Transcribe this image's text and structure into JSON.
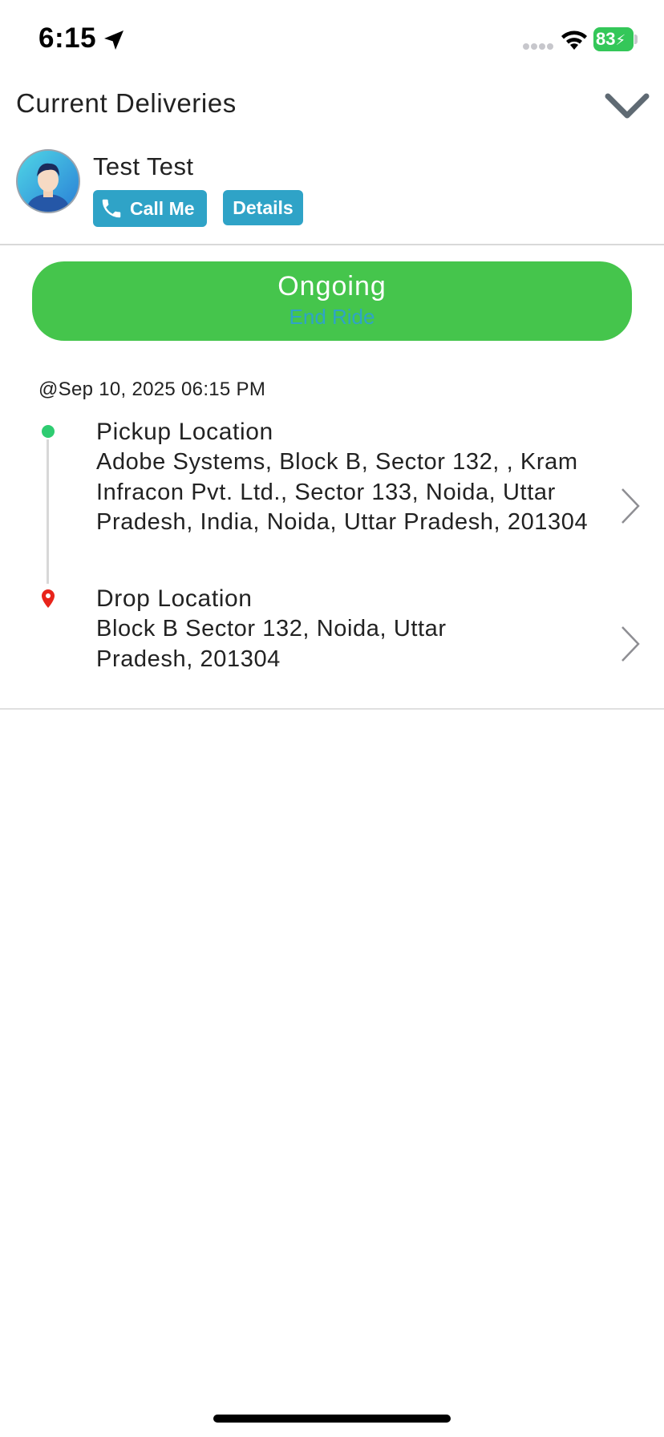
{
  "status_bar": {
    "time": "6:15",
    "battery": "83"
  },
  "header": {
    "title": "Current Deliveries"
  },
  "driver": {
    "name": "Test Test",
    "call_label": "Call Me",
    "details_label": "Details"
  },
  "ride": {
    "status_label": "Ongoing",
    "end_label": "End Ride",
    "timestamp": "@Sep 10, 2025 06:15 PM",
    "pickup": {
      "title": "Pickup Location",
      "address": "Adobe Systems, Block B, Sector 132, , Kram Infracon Pvt. Ltd., Sector 133, Noida, Uttar Pradesh, India, Noida, Uttar Pradesh, 201304"
    },
    "drop": {
      "title": "Drop Location",
      "address": "Block B Sector 132, Noida, Uttar Pradesh, 201304"
    }
  },
  "colors": {
    "accent": "#2fa3c7",
    "ongoing": "#45c54c",
    "pickup_dot": "#2ecc71",
    "drop_pin": "#e8241b"
  }
}
